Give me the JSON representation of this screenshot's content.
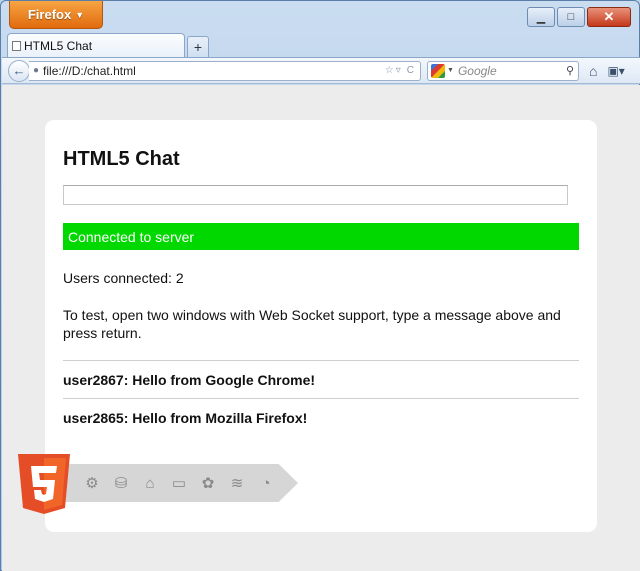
{
  "browser": {
    "menu_button": "Firefox",
    "tab_title": "HTML5 Chat",
    "url": "file:///D:/chat.html",
    "search_placeholder": "Google"
  },
  "page": {
    "title": "HTML5 Chat",
    "input_value": "",
    "status": "Connected to server",
    "status_color": "#00d800",
    "users_connected": "Users connected: 2",
    "instructions": "To test, open two windows with Web Socket support, type a message above and press return.",
    "messages": [
      "user2867: Hello from Google Chrome!",
      "user2865: Hello from Mozilla Firefox!"
    ],
    "badge_icons": [
      "semantics-icon",
      "offline-storage-icon",
      "device-access-icon",
      "connectivity-icon",
      "multimedia-icon",
      "performance-icon",
      "css3-styling-icon",
      "3d-graphics-icon"
    ]
  }
}
